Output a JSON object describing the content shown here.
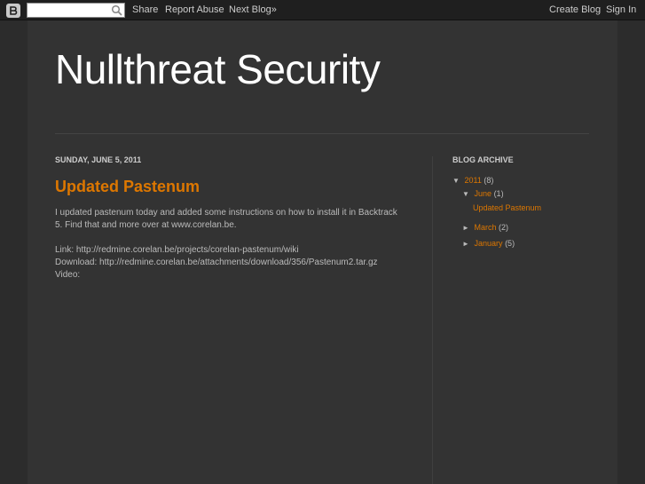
{
  "navbar": {
    "search": {
      "value": "",
      "placeholder": ""
    },
    "share": "Share",
    "report_abuse": "Report Abuse",
    "next_blog": "Next Blog»",
    "create_blog": "Create Blog",
    "sign_in": "Sign In"
  },
  "header": {
    "title": "Nullthreat Security"
  },
  "post": {
    "date": "SUNDAY, JUNE 5, 2011",
    "title": "Updated Pastenum",
    "body_line1": "I updated pastenum today and added some instructions on how to install it in Backtrack",
    "body_line2": "5. Find that and more over at www.corelan.be.",
    "link_line": "Link: http://redmine.corelan.be/projects/corelan-pastenum/wiki",
    "download_line": "Download: http://redmine.corelan.be/attachments/download/356/Pastenum2.tar.gz",
    "video_line": "Video:"
  },
  "sidebar": {
    "title": "BLOG ARCHIVE",
    "years": [
      {
        "toggle": "▼",
        "label": "2011",
        "count": "(8)",
        "months": [
          {
            "toggle": "▼",
            "label": "June",
            "count": "(1)",
            "posts": [
              "Updated Pastenum"
            ]
          },
          {
            "toggle": "►",
            "label": "March",
            "count": "(2)"
          },
          {
            "toggle": "►",
            "label": "January",
            "count": "(5)"
          }
        ]
      }
    ]
  },
  "colors": {
    "accent": "#dd7700",
    "background": "#2c2c2c",
    "content_bg": "#333333",
    "navbar_bg": "#1f1f1f"
  }
}
